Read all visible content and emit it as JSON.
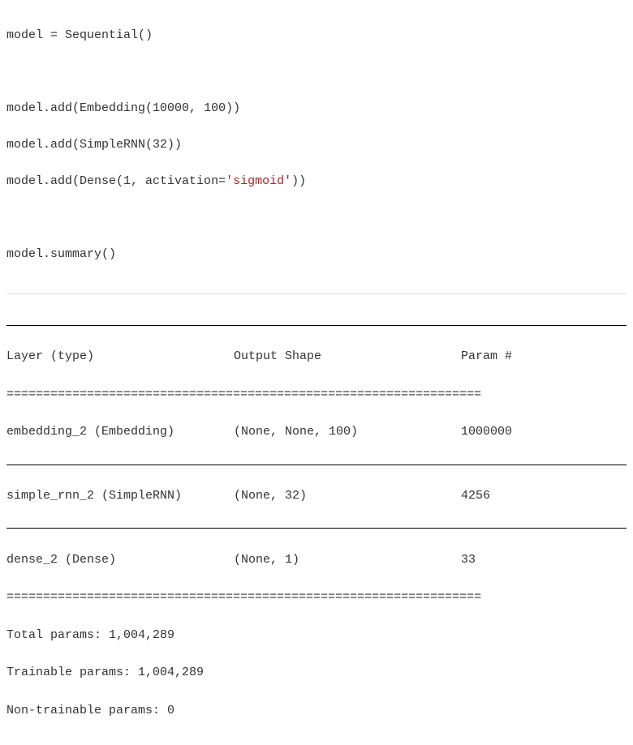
{
  "code": {
    "line1": "model = Sequential()",
    "blank1": " ",
    "line2a": "model.add(Embedding(",
    "line2b": "10000",
    "line2c": ", ",
    "line2d": "100",
    "line2e": "))",
    "line3a": "model.add(SimpleRNN(",
    "line3b": "32",
    "line3c": "))",
    "line4a": "model.add(Dense(",
    "line4b": "1",
    "line4c": ", activation=",
    "line4d": "'sigmoid'",
    "line4e": "))",
    "blank2": " ",
    "line5": "model.summary()"
  },
  "summary": {
    "header": {
      "c1": "Layer (type)",
      "c2": "Output Shape",
      "c3": "Param #"
    },
    "eq": "=================================================================",
    "rows": [
      {
        "c1": "embedding_2 (Embedding)",
        "c2": "(None, None, 100)",
        "c3": "1000000"
      },
      {
        "c1": "simple_rnn_2 (SimpleRNN)",
        "c2": "(None, 32)",
        "c3": "4256"
      },
      {
        "c1": "dense_2 (Dense)",
        "c2": "(None, 1)",
        "c3": "33"
      }
    ],
    "footer": {
      "total": "Total params: 1,004,289",
      "trainable": "Trainable params: 1,004,289",
      "nontrainable": "Non-trainable params: 0"
    }
  }
}
